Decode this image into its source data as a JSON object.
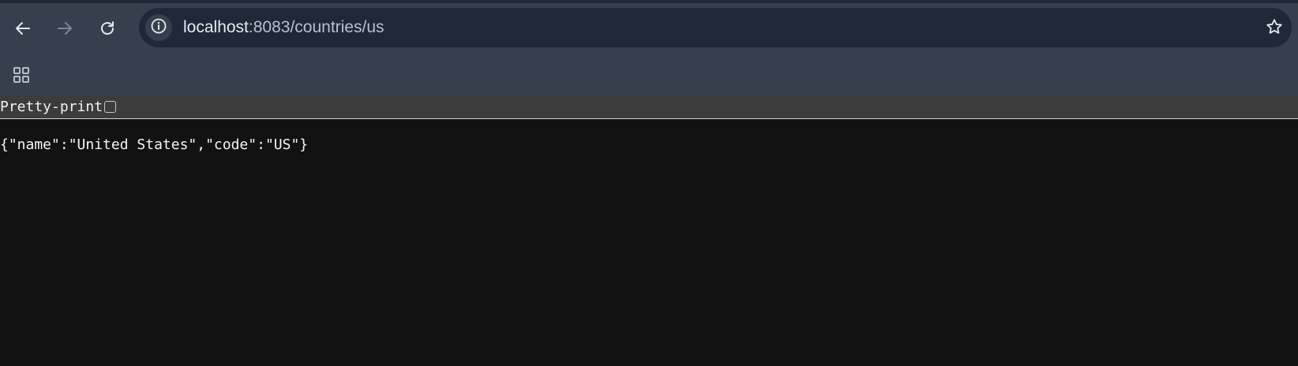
{
  "browser": {
    "url_host": "localhost",
    "url_path": ":8083/countries/us",
    "icons": {
      "back": "arrow-left-icon",
      "forward": "arrow-right-icon",
      "reload": "reload-icon",
      "site_info": "info-icon",
      "bookmark": "star-outline-icon",
      "apps": "apps-grid-icon"
    },
    "forward_enabled": false
  },
  "json_viewer": {
    "pretty_print_label": "Pretty-print",
    "pretty_print_checked": false,
    "raw_json": "{\"name\":\"United States\",\"code\":\"US\"}"
  },
  "colors": {
    "chrome_background": "#35404f",
    "omnibox_background": "#1e2838",
    "formatter_bar": "#3c3c3c",
    "page_background": "#121212"
  }
}
